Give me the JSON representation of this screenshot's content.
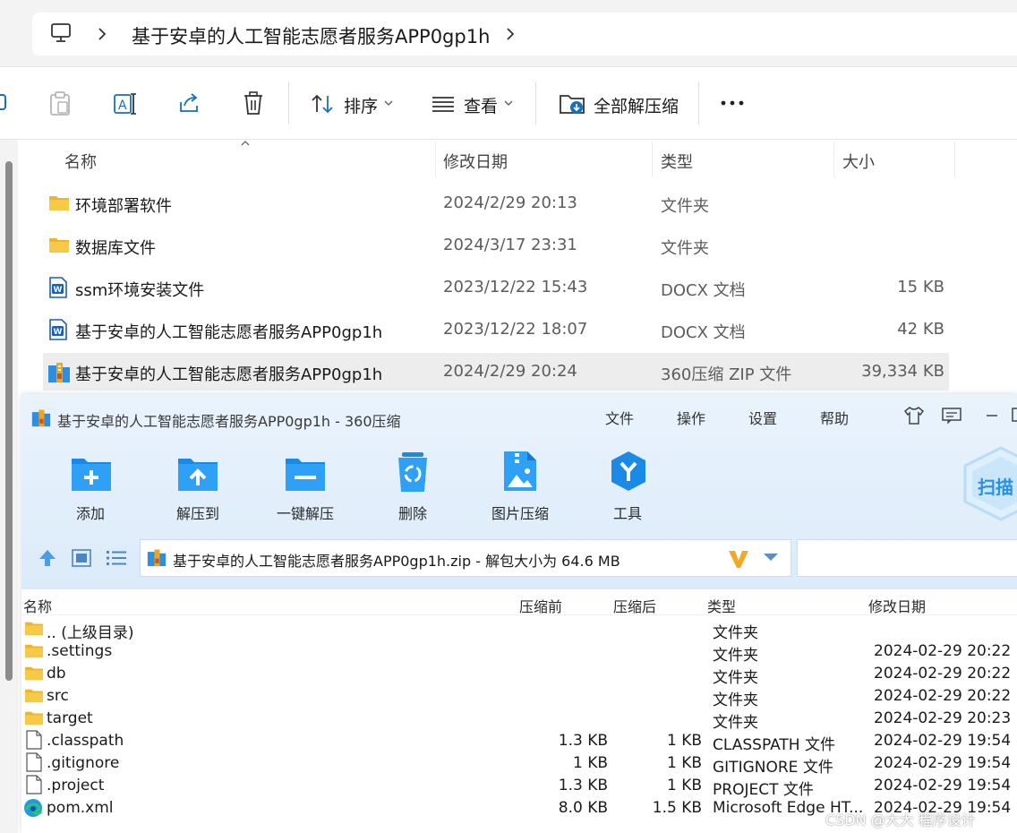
{
  "explorer": {
    "address": {
      "path": "基于安卓的人工智能志愿者服务APP0gp1h"
    },
    "toolbar": {
      "sort_label": "排序",
      "view_label": "查看",
      "extract_all_label": "全部解压缩"
    },
    "columns": {
      "name": "名称",
      "date": "修改日期",
      "type": "类型",
      "size": "大小"
    },
    "files": [
      {
        "name": "环境部署软件",
        "date": "2024/2/29 20:13",
        "type": "文件夹",
        "size": "",
        "icon": "folder-icon"
      },
      {
        "name": "数据库文件",
        "date": "2024/3/17 23:31",
        "type": "文件夹",
        "size": "",
        "icon": "folder-icon"
      },
      {
        "name": "ssm环境安装文件",
        "date": "2023/12/22 15:43",
        "type": "DOCX 文档",
        "size": "15 KB",
        "icon": "word-doc-icon"
      },
      {
        "name": "基于安卓的人工智能志愿者服务APP0gp1h",
        "date": "2023/12/22 18:07",
        "type": "DOCX 文档",
        "size": "42 KB",
        "icon": "word-doc-icon"
      },
      {
        "name": "基于安卓的人工智能志愿者服务APP0gp1h",
        "date": "2024/2/29 20:24",
        "type": "360压缩 ZIP 文件",
        "size": "39,334 KB",
        "icon": "zip-archive-icon",
        "selected": true
      }
    ]
  },
  "archiver": {
    "title": "基于安卓的人工智能志愿者服务APP0gp1h - 360压缩",
    "menu": [
      "文件",
      "操作",
      "设置",
      "帮助"
    ],
    "tools": [
      {
        "label": "添加",
        "icon": "add-icon"
      },
      {
        "label": "解压到",
        "icon": "extract-to-icon"
      },
      {
        "label": "一键解压",
        "icon": "one-click-extract-icon"
      },
      {
        "label": "删除",
        "icon": "recycle-icon"
      },
      {
        "label": "图片压缩",
        "icon": "image-compress-icon"
      },
      {
        "label": "工具",
        "icon": "tools-icon"
      }
    ],
    "scan_label": "扫描",
    "path_text": "基于安卓的人工智能志愿者服务APP0gp1h.zip - 解包大小为 64.6 MB",
    "columns": {
      "name": "名称",
      "before": "压缩前",
      "after": "压缩后",
      "type": "类型",
      "date": "修改日期"
    },
    "files": [
      {
        "name": ".. (上级目录)",
        "before": "",
        "after": "",
        "type": "文件夹",
        "date": "",
        "icon": "folder-icon"
      },
      {
        "name": ".settings",
        "before": "",
        "after": "",
        "type": "文件夹",
        "date": "2024-02-29 20:22",
        "icon": "folder-icon"
      },
      {
        "name": "db",
        "before": "",
        "after": "",
        "type": "文件夹",
        "date": "2024-02-29 20:22",
        "icon": "folder-icon"
      },
      {
        "name": "src",
        "before": "",
        "after": "",
        "type": "文件夹",
        "date": "2024-02-29 20:22",
        "icon": "folder-icon"
      },
      {
        "name": "target",
        "before": "",
        "after": "",
        "type": "文件夹",
        "date": "2024-02-29 20:23",
        "icon": "folder-icon"
      },
      {
        "name": ".classpath",
        "before": "1.3 KB",
        "after": "1 KB",
        "type": "CLASSPATH 文件",
        "date": "2024-02-29 19:54",
        "icon": "file-icon"
      },
      {
        "name": ".gitignore",
        "before": "1 KB",
        "after": "1 KB",
        "type": "GITIGNORE 文件",
        "date": "2024-02-29 19:54",
        "icon": "file-icon"
      },
      {
        "name": ".project",
        "before": "1.3 KB",
        "after": "1 KB",
        "type": "PROJECT 文件",
        "date": "2024-02-29 19:54",
        "icon": "file-icon"
      },
      {
        "name": "pom.xml",
        "before": "8.0 KB",
        "after": "1.5 KB",
        "type": "Microsoft Edge HT...",
        "date": "2024-02-29 19:54",
        "icon": "edge-icon"
      }
    ]
  },
  "watermark": "CSDN @大大 程序设计",
  "colors": {
    "accent_blue": "#1a8ae6",
    "folder_yellow": "#f7c948",
    "selection_gray": "#ededed"
  }
}
